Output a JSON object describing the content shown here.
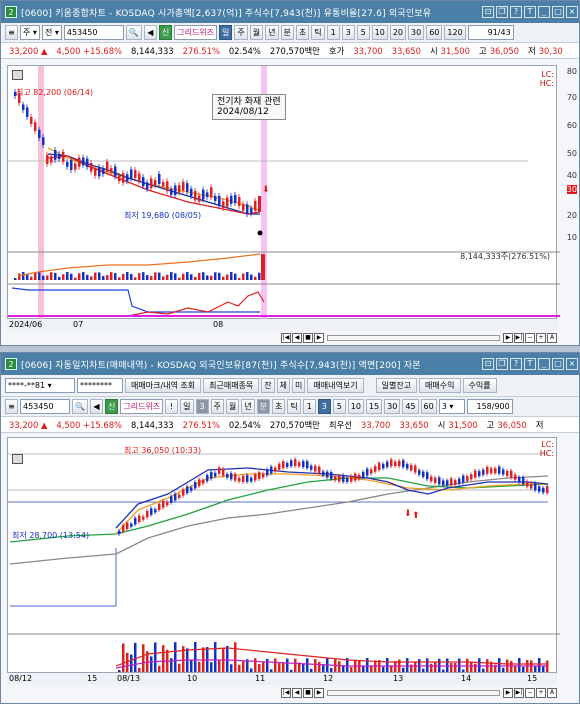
{
  "w1": {
    "num": "2",
    "title": "[0600] 키움종합차트 - KOSDAQ 시가총액[2,637(억)] 주식수[7,943(천)] 유통비율[27.6] 외국인보유",
    "period": "주",
    "jeon": "전",
    "code": "453450",
    "gridwiz": "그리드위즈",
    "periods": [
      "일",
      "주",
      "월",
      "년",
      "분",
      "초",
      "틱"
    ],
    "nums": [
      "1",
      "3",
      "5",
      "10",
      "20",
      "30",
      "60",
      "120"
    ],
    "counter": "91/43",
    "quote": {
      "price": "33,200 ▲",
      "change": "4,500 +15.68%",
      "volume": "8,144,333",
      "turnover": "276.51%",
      "ratio": "02.54%",
      "amount": "270,570백만",
      "hoga_label": "호가",
      "hoga1": "33,700",
      "hoga2": "33,650",
      "open_l": "시",
      "open": "31,500",
      "high_l": "고",
      "high": "36,050",
      "low_l": "저",
      "low": "30,30"
    },
    "high_ann": "최고 82,200 (06/14)",
    "low_ann": "최저 19,680 (08/05)",
    "box_title": "전기차 화재 관련",
    "box_date": "2024/08/12",
    "vol_label": "8,144,333주(276.51%)",
    "lc": [
      "LC:",
      "HC:"
    ],
    "yticks": [
      "80",
      "70",
      "60",
      "50",
      "40",
      "30",
      "20",
      "10"
    ],
    "xticks": [
      "2024/06",
      "07",
      "08"
    ]
  },
  "w2": {
    "num": "2",
    "title": "[0606] 자동일지차트(매매내역) - KOSDAQ 외국인보유[87(천)] 주식수[7,943(천)] 액면[200] 자본",
    "account": "****-**81",
    "password": "********",
    "btn_mark": "매매마크/내역 조회",
    "btn_recent": "최근매매종목",
    "btn_jan": "잔",
    "btn_che": "체",
    "btn_mi": "미",
    "btn_view": "매매내역보기",
    "btn_daily": "일별잔고",
    "btn_profit": "매매수익",
    "btn_rate": "수익률",
    "code": "453450",
    "gridwiz": "그리드위즈",
    "excl": "!",
    "day": "일",
    "step": "3",
    "periods": [
      "주",
      "월",
      "년",
      "분",
      "초",
      "틱"
    ],
    "nums": [
      "1",
      "3",
      "5",
      "10",
      "15",
      "30",
      "45",
      "60"
    ],
    "sel_num": "3",
    "counter": "158/900",
    "quote": {
      "price": "33,200 ▲",
      "change": "4,500 +15.68%",
      "volume": "8,144,333",
      "turnover": "276.51%",
      "ratio": "02.54%",
      "amount": "270,570백만",
      "best_l": "최우선",
      "hoga1": "33,700",
      "hoga2": "33,650",
      "open_l": "시",
      "open": "31,500",
      "high_l": "고",
      "high": "36,050",
      "low_l": "저"
    },
    "high_ann": "최고 36,050 (10:33)",
    "low_ann": "최저 28,700 (13:54)",
    "lc": [
      "LC:",
      "HC:"
    ],
    "xticks": [
      "08/12",
      "15",
      "08/13",
      "10",
      "11",
      "12",
      "13",
      "14",
      "15"
    ]
  }
}
